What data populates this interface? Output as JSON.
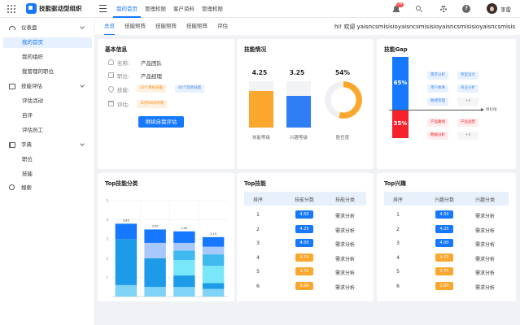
{
  "app": {
    "name": "技能驱动型组织",
    "user_name": "李雷",
    "notification_count": "18"
  },
  "top_nav": [
    {
      "label": "我的首页",
      "active": true
    },
    {
      "label": "管理权限",
      "active": false
    },
    {
      "label": "客户资料",
      "active": false
    },
    {
      "label": "管理权限",
      "active": false
    }
  ],
  "sidebar": {
    "groups": [
      {
        "label": "仪表盘",
        "icon": "dashboard-icon",
        "items": [
          "我的首页",
          "我的组织",
          "我管理的职位"
        ]
      },
      {
        "label": "技能评估",
        "icon": "document-icon",
        "items": [
          "评估活动",
          "自评",
          "评估员工"
        ]
      },
      {
        "label": "字典",
        "icon": "book-icon",
        "items": [
          "职位",
          "技能"
        ]
      }
    ],
    "search_label": "搜索",
    "active_item": "我的首页"
  },
  "sub_tabs": [
    {
      "label": "总览",
      "active": true
    },
    {
      "label": "技能矩阵",
      "active": false
    },
    {
      "label": "技能矩阵",
      "active": false
    },
    {
      "label": "技能矩阵",
      "active": false
    },
    {
      "label": "评估",
      "active": false
    }
  ],
  "greeting": "hi! 欢迎 yaisncsmisisioyaisncsmisisioyaisncsmisisioyaisncsmisisio",
  "basic_info": {
    "title": "基本信息",
    "name_label": "名称:",
    "name_value": "产品团队",
    "position_label": "职位:",
    "position_value": "产品经理",
    "skill_label": "技能:",
    "skill_tags": [
      "23个目标技能",
      "46个其他技能"
    ],
    "eval_label": "评估:",
    "eval_tag": "10月08日开始",
    "button": "继续自我评估"
  },
  "skill_status": {
    "title": "技能情况",
    "items": [
      {
        "value": "4.25",
        "label": "技能等级",
        "ratio": 0.79,
        "color": "#fba72e"
      },
      {
        "value": "3.25",
        "label": "兴趣等级",
        "ratio": 0.69,
        "color": "#2f7ef5"
      },
      {
        "value": "54%",
        "label": "胜任度",
        "ratio": 0.54,
        "color": "#fba72e"
      }
    ]
  },
  "skill_gap": {
    "title": "技能Gap",
    "axis_label": "目标线",
    "positive": {
      "value": "65%",
      "ratio": 0.65,
      "tags": [
        "需求分析",
        "原型设计",
        "用户故事",
        "商业分析",
        "敏捷管理",
        "+4"
      ]
    },
    "negative": {
      "value": "35%",
      "ratio": 0.35,
      "tags": [
        "产品路线",
        "产品运营",
        "数据分析",
        "+4"
      ]
    }
  },
  "top_category": {
    "title": "Top技能分类",
    "chart_data": {
      "type": "bar",
      "stacked": true,
      "ylim": [
        0,
        5
      ],
      "yticks": [
        "1",
        "2",
        "3",
        "4",
        "5"
      ],
      "categories": [
        "A",
        "B",
        "C",
        "D"
      ],
      "totals": [
        3.8,
        3.5,
        3.4,
        3.1
      ],
      "data_labels": [
        "3.85",
        "3.50",
        "3.40",
        "3.10"
      ],
      "series": [
        {
          "values": [
            0.6,
            0.5,
            0.5,
            0.4
          ],
          "color": "#7fd3f7"
        },
        {
          "values": [
            2.4,
            1.5,
            0.6,
            0.3
          ],
          "color": "#1e9be8"
        },
        {
          "values": [
            0,
            0,
            0.8,
            0.9
          ],
          "color": "#78e7f7"
        },
        {
          "values": [
            0,
            0,
            0.5,
            0.6
          ],
          "color": "#40b9ee"
        },
        {
          "values": [
            0,
            0.8,
            0.4,
            0.4
          ],
          "color": "#a7c8fb"
        },
        {
          "values": [
            0.8,
            0.7,
            0.6,
            0.5
          ],
          "color": "#1677ff"
        }
      ]
    }
  },
  "top_skills": {
    "title": "Top技能",
    "headers": [
      "排序",
      "技能分数",
      "技能分类"
    ],
    "rows": [
      {
        "rank": "1",
        "score": "4.50",
        "category": "需求分析",
        "color": "blue"
      },
      {
        "rank": "2",
        "score": "4.25",
        "category": "需求分析",
        "color": "blue"
      },
      {
        "rank": "3",
        "score": "4.00",
        "category": "需求分析",
        "color": "blue"
      },
      {
        "rank": "4",
        "score": "3.75",
        "category": "需求分析",
        "color": "orange"
      },
      {
        "rank": "5",
        "score": "3.75",
        "category": "需求分析",
        "color": "orange"
      },
      {
        "rank": "6",
        "score": "3.00",
        "category": "需求分析",
        "color": "orange"
      }
    ]
  },
  "top_interests": {
    "title": "Top兴趣",
    "headers": [
      "排序",
      "兴趣分数",
      "兴趣分类"
    ],
    "rows": [
      {
        "rank": "1",
        "score": "4.50",
        "category": "需求分析",
        "color": "blue"
      },
      {
        "rank": "2",
        "score": "4.25",
        "category": "需求分析",
        "color": "blue"
      },
      {
        "rank": "3",
        "score": "4.00",
        "category": "需求分析",
        "color": "blue"
      },
      {
        "rank": "4",
        "score": "3.75",
        "category": "需求分析",
        "color": "orange"
      },
      {
        "rank": "5",
        "score": "3.75",
        "category": "需求分析",
        "color": "orange"
      },
      {
        "rank": "6",
        "score": "3.00",
        "category": "需求分析",
        "color": "orange"
      }
    ]
  }
}
